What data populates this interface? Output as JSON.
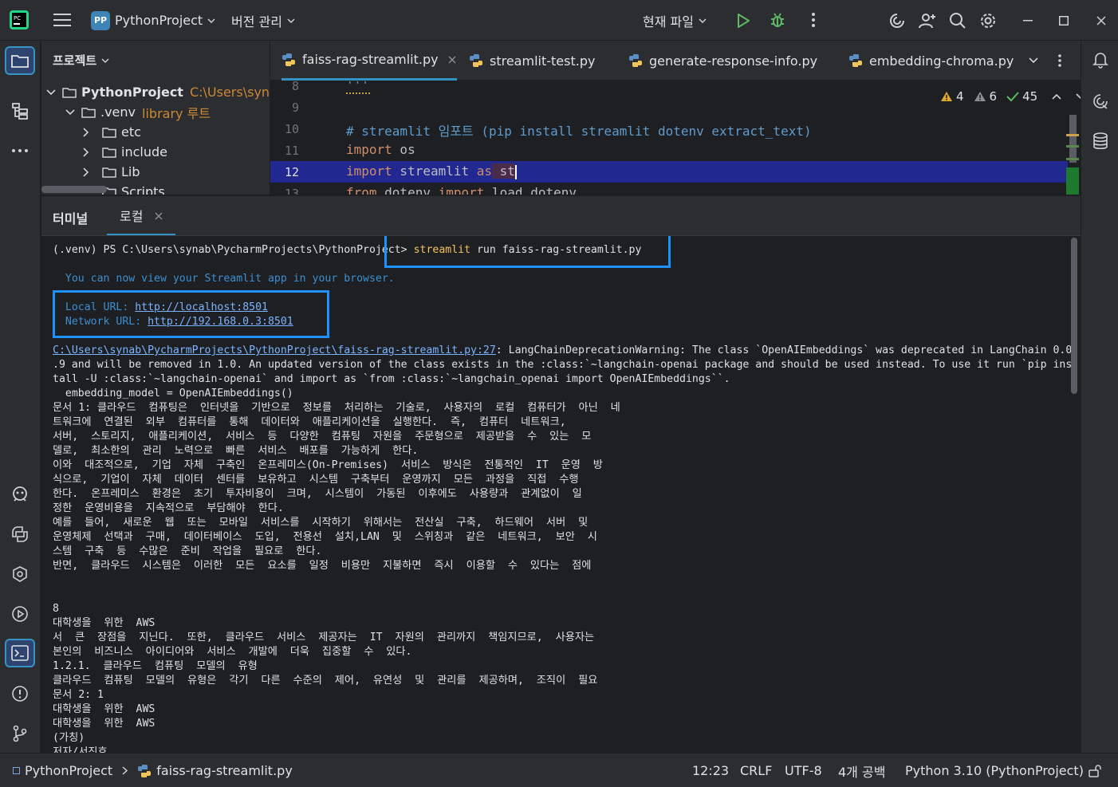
{
  "titlebar": {
    "project_badge": "PP",
    "project_name": "PythonProject",
    "vcs": "버전 관리",
    "run_config": "현재 파일"
  },
  "project_panel": {
    "title": "프로젝트",
    "root_name": "PythonProject",
    "root_path": "C:\\Users\\synab\\Pyc",
    "venv_name": ".venv",
    "venv_hint": "library 루트",
    "children": [
      "etc",
      "include",
      "Lib",
      "Scripts"
    ]
  },
  "editor_tabs": [
    {
      "label": "faiss-rag-streamlit.py",
      "active": true
    },
    {
      "label": "streamlit-test.py",
      "active": false
    },
    {
      "label": "generate-response-info.py",
      "active": false
    },
    {
      "label": "embedding-chroma.py",
      "active": false
    }
  ],
  "inspections": {
    "warnings": "4",
    "weak_warnings": "6",
    "ok": "45"
  },
  "editor_lines": [
    {
      "num": "8",
      "text": "'''"
    },
    {
      "num": "9",
      "text": ""
    },
    {
      "num": "10",
      "text": "# streamlit 임포트 (pip install streamlit dotenv extract_text)"
    },
    {
      "num": "11",
      "kw": "import",
      "rest": " os"
    },
    {
      "num": "12",
      "kw": "import",
      "rest": " streamlit ",
      "kw2": "as",
      "rest2": " st"
    },
    {
      "num": "13",
      "kw": "from",
      "rest": " dotenv ",
      "kw2": "import",
      "rest2": " load_dotenv"
    }
  ],
  "terminal_tabs": {
    "terminal": "터미널",
    "local": "로컬"
  },
  "terminal": {
    "prompt": "(.venv) PS C:\\Users\\synab\\PycharmProjects\\PythonProject> ",
    "cmd_word": "streamlit",
    "cmd_rest": " run faiss-rag-streamlit.py",
    "view_msg": "  You can now view your Streamlit app in your browser.",
    "local_label": "  Local URL: ",
    "local_url": "http://localhost:8501",
    "network_label": "  Network URL: ",
    "network_url": "http://192.168.0.3:8501",
    "warn_link": "C:\\Users\\synab\\PycharmProjects\\PythonProject\\faiss-rag-streamlit.py:27",
    "warn_rest": ": LangChainDeprecationWarning: The class `OpenAIEmbeddings` was deprecated in LangChain 0.0",
    "lines": [
      ".9 and will be removed in 1.0. An updated version of the class exists in the :class:`~langchain-openai package and should be used instead. To use it run `pip ins",
      "tall -U :class:`~langchain-openai` and import as `from :class:`~langchain_openai import OpenAIEmbeddings``.",
      "  embedding_model = OpenAIEmbeddings()",
      "문서 1: 클라우드  컴퓨팅은  인터넷을  기반으로  정보를  처리하는  기술로,  사용자의  로컬  컴퓨터가  아닌  네",
      "트워크에  연결된  외부  컴퓨터를  통해  데이터와  애플리케이션을  실행한다.  즉,  컴퓨터  네트워크,",
      "서버,  스토리지,  애플리케이션,  서비스  등  다양한  컴퓨팅  자원을  주문형으로  제공받을  수  있는  모",
      "델로,  최소한의  관리  노력으로  빠른  서비스  배포를  가능하게  한다.",
      "이와  대조적으로,  기업  자체  구축인  온프레미스(On-Premises)  서비스  방식은  전통적인  IT  운영  방",
      "식으로,  기업이  자체  데이터  센터를  보유하고  시스템  구축부터  운영까지  모든  과정을  직접  수행",
      "한다.  온프레미스  환경은  초기  투자비용이  크며,  시스템이  가동된  이후에도  사용량과  관계없이  일",
      "정한  운영비용을  지속적으로  부담해야  한다.",
      "예를  들어,  새로운  웹  또는  모바일  서비스를  시작하기  위해서는  전산실  구축,  하드웨어  서버  및",
      "운영체제  선택과  구매,  데이터베이스  도입,  전용선  설치,LAN  및  스위칭과  같은  네트워크,  보안  시",
      "스템  구축  등  수많은  준비  작업을  필요로  한다.",
      "반면,  클라우드  시스템은  이러한  모든  요소를  일정  비용만  지불하면  즉시  이용할  수  있다는  점에",
      "",
      "",
      "8",
      "대학생을  위한  AWS",
      "서  큰  장점을  지닌다.  또한,  클라우드  서비스  제공자는  IT  자원의  관리까지  책임지므로,  사용자는",
      "본인의  비즈니스  아이디어와  서비스  개발에  더욱  집중할  수  있다.",
      "1.2.1.  클라우드  컴퓨팅  모델의  유형",
      "클라우드  컴퓨팅  모델의  유형은  각기  다른  수준의  제어,  유연성  및  관리를  제공하며,  조직이  필요",
      "문서 2: 1",
      "대학생을  위한  AWS",
      "대학생을  위한  AWS",
      "(가칭)",
      "저자/서진호"
    ]
  },
  "statusbar": {
    "breadcrumb_project": "PythonProject",
    "breadcrumb_file": "faiss-rag-streamlit.py",
    "position": "12:23",
    "line_sep": "CRLF",
    "encoding": "UTF-8",
    "indent": "4개 공백",
    "interpreter": "Python 3.10 (PythonProject)"
  },
  "colors": {
    "accent": "#3592c4",
    "highlight_box": "#1e90ff",
    "current_line": "#21288f"
  }
}
